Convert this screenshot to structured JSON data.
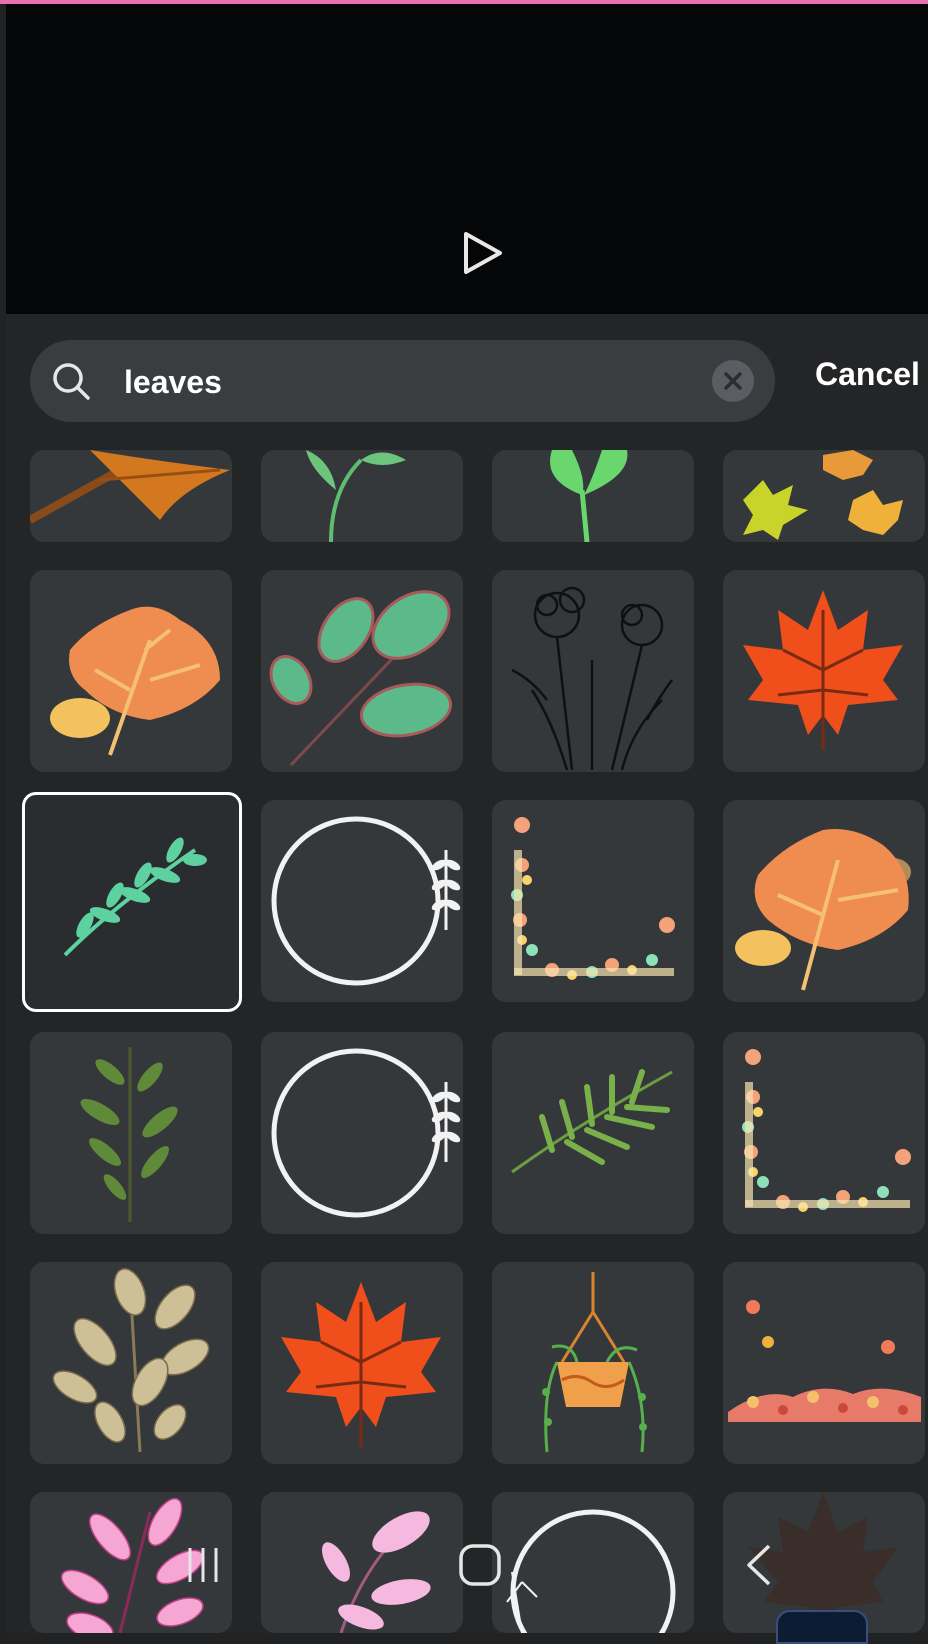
{
  "search": {
    "query": "leaves",
    "cancel_label": "Cancel"
  },
  "colors": {
    "accent_top": "#e86fb0",
    "tile_bg": "#35383b",
    "selected_border": "#ffffff"
  },
  "results": [
    {
      "name": "autumn-leaf-orange"
    },
    {
      "name": "green-sprout"
    },
    {
      "name": "green-leaf-stem"
    },
    {
      "name": "maple-leaves-yellow"
    },
    {
      "name": "orange-autumn-leaf"
    },
    {
      "name": "green-branch-leaves"
    },
    {
      "name": "line-art-flowers"
    },
    {
      "name": "red-maple-leaf"
    },
    {
      "name": "green-twig",
      "selected": true
    },
    {
      "name": "circle-frame-leaves"
    },
    {
      "name": "floral-corner-frame"
    },
    {
      "name": "orange-autumn-leaf-2"
    },
    {
      "name": "watercolor-green-branch"
    },
    {
      "name": "circle-frame-leaves-2"
    },
    {
      "name": "palm-branch"
    },
    {
      "name": "floral-corner-frame-2"
    },
    {
      "name": "beige-leaves-branch"
    },
    {
      "name": "red-maple-leaf-2"
    },
    {
      "name": "hanging-plant-pot"
    },
    {
      "name": "autumn-leaves-border"
    },
    {
      "name": "pink-leaves-branch"
    },
    {
      "name": "pink-leaf-twig"
    },
    {
      "name": "circle-frame-3"
    },
    {
      "name": "dark-leaves"
    }
  ],
  "navbar": {
    "icons": [
      "recent-apps-icon",
      "home-icon",
      "back-icon"
    ]
  }
}
